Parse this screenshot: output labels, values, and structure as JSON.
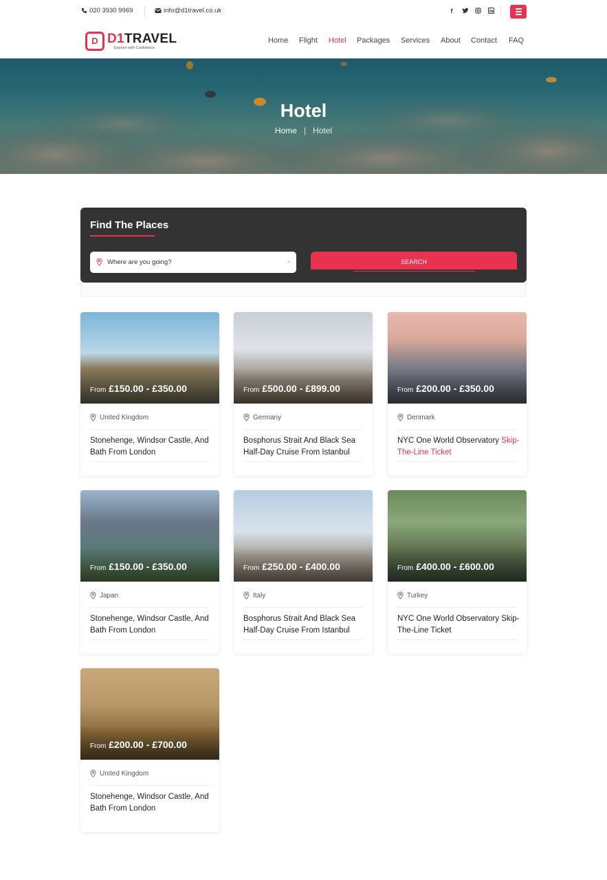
{
  "topbar": {
    "phone": "020 3930 9969",
    "email": "info@d1travel.co.uk",
    "socials": [
      "facebook-icon",
      "twitter-icon",
      "instagram-icon",
      "linkedin-icon"
    ]
  },
  "brand": {
    "name_part1": "D1",
    "name_part2": "TRAVEL",
    "tagline": "Explore with Confidence"
  },
  "nav": {
    "items": [
      {
        "label": "Home"
      },
      {
        "label": "Flight"
      },
      {
        "label": "Hotel"
      },
      {
        "label": "Packages"
      },
      {
        "label": "Services"
      },
      {
        "label": "About"
      },
      {
        "label": "Contact"
      },
      {
        "label": "FAQ"
      }
    ],
    "active": "Hotel"
  },
  "hero": {
    "title": "Hotel",
    "breadcrumb": [
      "Home",
      "Hotel"
    ]
  },
  "search": {
    "heading": "Find The Places",
    "placeholder": "Where are you going?",
    "button": "SEARCH"
  },
  "cards": [
    {
      "from": "From",
      "price": "£150.00 - £350.00",
      "location": "United Kingdom",
      "title": "Stonehenge, Windsor Castle, And Bath From London",
      "title_highlight": ""
    },
    {
      "from": "From",
      "price": "£500.00 - £899.00",
      "location": "Germany",
      "title": "Bosphorus Strait And Black Sea Half-Day Cruise From Istanbul",
      "title_highlight": ""
    },
    {
      "from": "From",
      "price": "£200.00 - £350.00",
      "location": "Denmark",
      "title": "NYC One World Observatory",
      "title_highlight": "Skip-The-Line Ticket"
    },
    {
      "from": "From",
      "price": "£150.00 - £350.00",
      "location": "Japan",
      "title": "Stonehenge, Windsor Castle, And Bath From London",
      "title_highlight": ""
    },
    {
      "from": "From",
      "price": "£250.00 - £400.00",
      "location": "Italy",
      "title": "Bosphorus Strait And Black Sea Half-Day Cruise From Istanbul",
      "title_highlight": ""
    },
    {
      "from": "From",
      "price": "£400.00 - £600.00",
      "location": "Turkey",
      "title": "NYC One World Observatory Skip-The-Line Ticket",
      "title_highlight": ""
    },
    {
      "from": "From",
      "price": "£200.00 - £700.00",
      "location": "United Kingdom",
      "title": "Stonehenge, Windsor Castle, And Bath From London",
      "title_highlight": ""
    }
  ],
  "colors": {
    "accent": "#e8324f",
    "panel": "#333333"
  }
}
